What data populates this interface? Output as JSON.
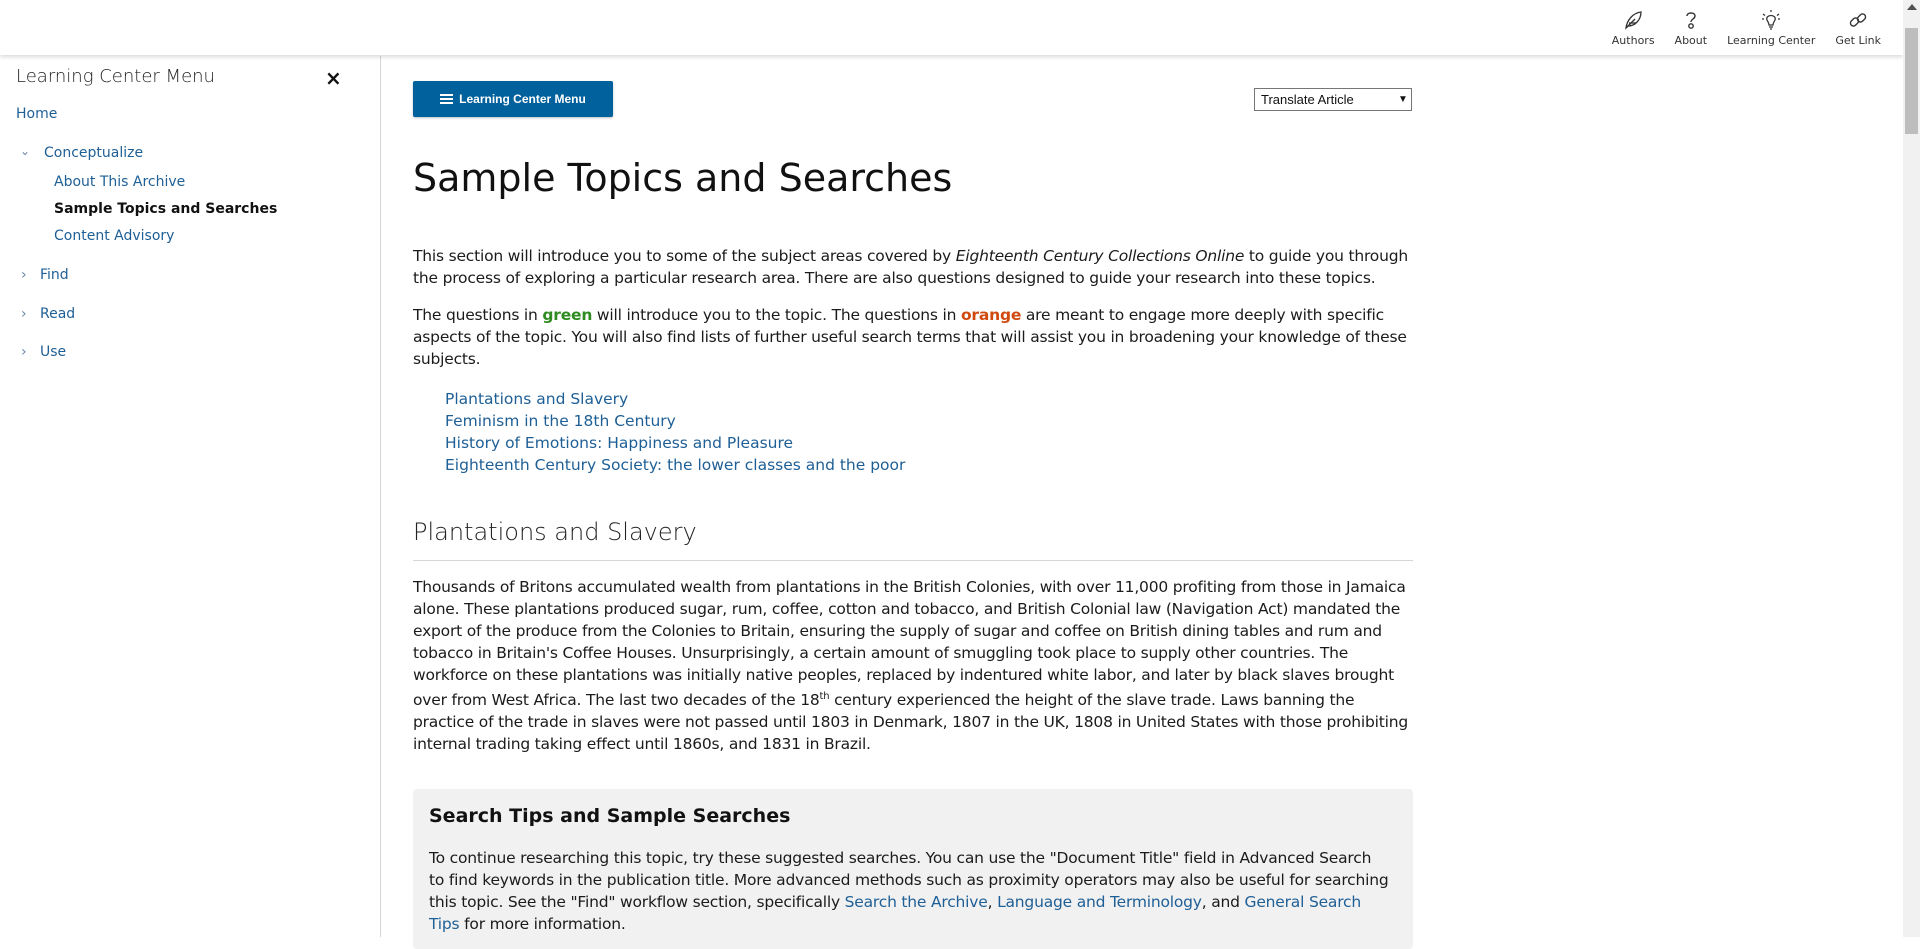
{
  "header": {
    "tools": [
      {
        "label": "Authors",
        "icon": "feather-icon"
      },
      {
        "label": "About",
        "icon": "question-icon"
      },
      {
        "label": "Learning Center",
        "icon": "lightbulb-icon"
      },
      {
        "label": "Get Link",
        "icon": "link-icon"
      }
    ]
  },
  "sidebar": {
    "title": "Learning Center Menu",
    "close_icon": "×",
    "home": "Home",
    "sections": [
      {
        "label": "Conceptualize",
        "expanded": true,
        "children": [
          {
            "label": "About This Archive",
            "active": false
          },
          {
            "label": "Sample Topics and Searches",
            "active": true
          },
          {
            "label": "Content Advisory",
            "active": false
          }
        ]
      },
      {
        "label": "Find",
        "expanded": false
      },
      {
        "label": "Read",
        "expanded": false
      },
      {
        "label": "Use",
        "expanded": false
      }
    ]
  },
  "main": {
    "menu_button_label": "Learning Center Menu",
    "translate_select": {
      "selected": "Translate Article"
    },
    "title": "Sample Topics and Searches",
    "intro": {
      "part1": "This section will introduce you to some of the subject areas covered by ",
      "italic": "Eighteenth Century Collections Online",
      "part2": " to guide you through the process of exploring a particular research area. There are also questions designed to guide your research into these topics."
    },
    "colors_para": {
      "part1": "The questions in ",
      "green_word": "green",
      "part2": " will introduce you to the topic. The questions in ",
      "orange_word": "orange",
      "part3": "  are meant to engage more deeply with specific aspects of the topic. You will also find lists of further useful search terms that will assist you in broadening your knowledge of these subjects."
    },
    "topics": [
      "Plantations and Slavery",
      "Feminism in the 18th Century",
      "History of Emotions: Happiness and Pleasure",
      "Eighteenth Century Society: the lower classes and the poor"
    ],
    "section_title": "Plantations and Slavery",
    "section_body": {
      "part1": "Thousands of Britons accumulated wealth from plantations in the British Colonies, with over 11,000 profiting from those in Jamaica alone. These plantations produced sugar, rum, coffee, cotton and tobacco, and British Colonial law (Navigation Act) mandated the export of the produce from the Colonies to Britain, ensuring the supply of sugar and coffee on British dining tables and rum and tobacco in Britain's Coffee Houses. Unsurprisingly, a certain amount of smuggling took place to supply other countries. The workforce on these plantations was initially native peoples, replaced by indentured white labor, and later by black slaves brought over from West Africa. The last two decades of the 18",
      "sup": "th",
      "part2": " century experienced the height of the slave trade. Laws banning the practice of the trade in slaves were not passed until 1803 in Denmark, 1807 in the UK, 1808 in United States with those prohibiting internal trading taking effect until 1860s, and 1831 in Brazil."
    },
    "tips": {
      "title": "Search Tips and Sample Searches",
      "part1": "To continue researching this topic, try these suggested searches. You can use the \"Document Title\" field in Advanced Search to find keywords in the publication title. More advanced methods such as proximity operators may also be useful for searching this topic. See the \"Find\" workflow section, specifically ",
      "link1": "Search the Archive",
      "sep1": ", ",
      "link2": "Language and Terminology",
      "sep2": ", and ",
      "link3": "General Search Tips",
      "part2": " for more information."
    }
  },
  "colors": {
    "accent": "#00619c",
    "link": "#1e5f96",
    "green": "#2e8b1f",
    "orange": "#d04a10"
  }
}
